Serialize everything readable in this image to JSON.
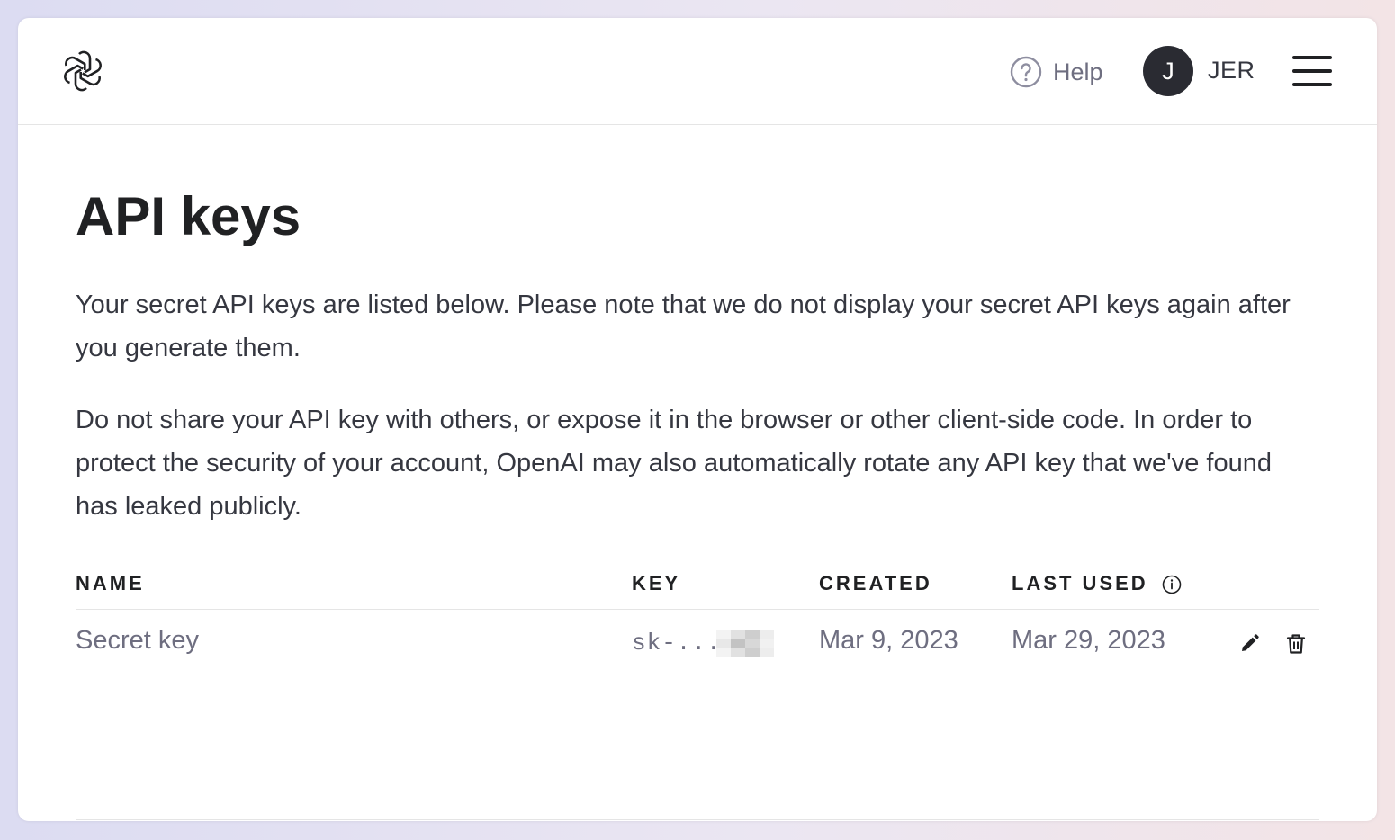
{
  "header": {
    "help_label": "Help",
    "avatar_initial": "J",
    "user_label": "JER"
  },
  "main": {
    "title": "API keys",
    "paragraphs": [
      "Your secret API keys are listed below. Please note that we do not display your secret API keys again after you generate them.",
      "Do not share your API key with others, or expose it in the browser or other client-side code. In order to protect the security of your account, OpenAI may also automatically rotate any API key that we've found has leaked publicly."
    ]
  },
  "table": {
    "columns": [
      "NAME",
      "KEY",
      "CREATED",
      "LAST USED"
    ],
    "rows": [
      {
        "name": "Secret key",
        "key": "sk-...",
        "created": "Mar 9, 2023",
        "last_used": "Mar 29, 2023"
      }
    ]
  },
  "icons": {
    "logo": "openai-logo",
    "help": "question-circle-icon",
    "menu": "hamburger-menu-icon",
    "info": "info-circle-icon",
    "edit": "pencil-icon",
    "delete": "trash-icon"
  },
  "colors": {
    "avatar_bg": "#2a2b32",
    "text_primary": "#202123",
    "text_secondary": "#6e6e80"
  }
}
